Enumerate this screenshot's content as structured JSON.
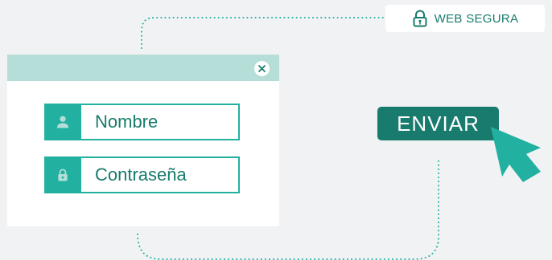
{
  "security_badge": {
    "label": "WEB SEGURA",
    "icon": "lock-icon"
  },
  "login_window": {
    "close_icon": "close-icon",
    "fields": [
      {
        "placeholder": "Nombre",
        "icon": "user-icon"
      },
      {
        "placeholder": "Contraseña",
        "icon": "lock-icon"
      }
    ]
  },
  "submit": {
    "label": "ENVIAR"
  },
  "pointer": {
    "icon": "cursor-arrow-icon"
  },
  "colors": {
    "background": "#f1f2f4",
    "accent": "#22b1a1",
    "accent_dark": "#187b6d",
    "header": "#b5ded8",
    "surface": "#ffffff"
  }
}
